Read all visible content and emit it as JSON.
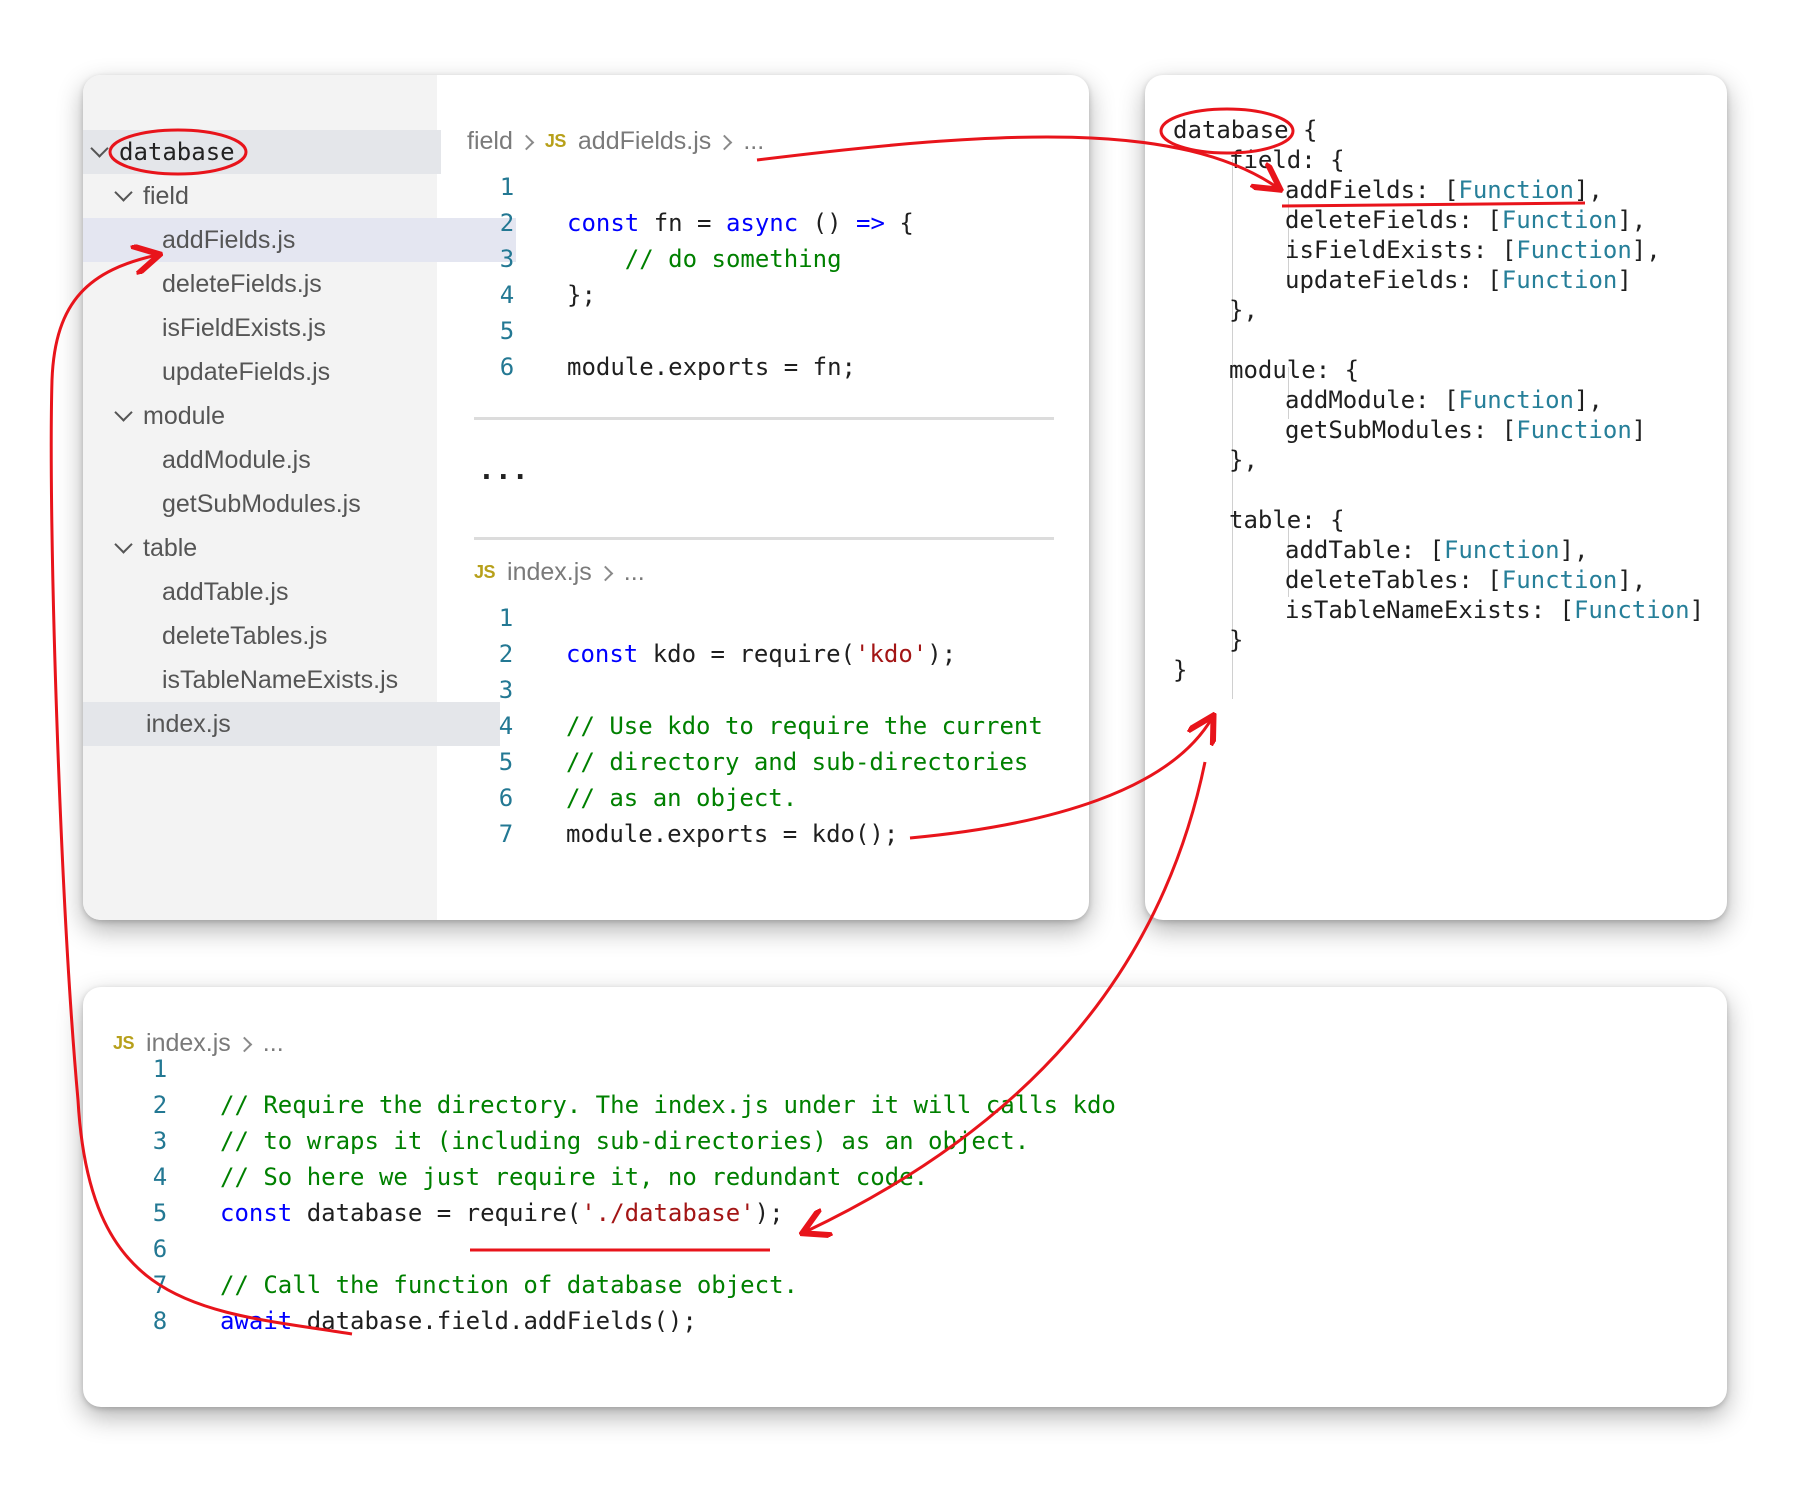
{
  "explorer": {
    "root": "database",
    "items": [
      {
        "label": "field",
        "type": "folder"
      },
      {
        "label": "addFields.js",
        "type": "file"
      },
      {
        "label": "deleteFields.js",
        "type": "file"
      },
      {
        "label": "isFieldExists.js",
        "type": "file"
      },
      {
        "label": "updateFields.js",
        "type": "file"
      },
      {
        "label": "module",
        "type": "folder"
      },
      {
        "label": "addModule.js",
        "type": "file"
      },
      {
        "label": "getSubModules.js",
        "type": "file"
      },
      {
        "label": "table",
        "type": "folder"
      },
      {
        "label": "addTable.js",
        "type": "file"
      },
      {
        "label": "deleteTables.js",
        "type": "file"
      },
      {
        "label": "isTableNameExists.js",
        "type": "file"
      },
      {
        "label": "index.js",
        "type": "file"
      }
    ]
  },
  "editor_top": {
    "breadcrumb": {
      "folder": "field",
      "badge": "JS",
      "file": "addFields.js",
      "more": "..."
    },
    "lines": [
      {
        "n": "1",
        "parts": []
      },
      {
        "n": "2",
        "parts": [
          {
            "t": "const",
            "c": "kw"
          },
          {
            "t": " fn = "
          },
          {
            "t": "async",
            "c": "kw"
          },
          {
            "t": " () "
          },
          {
            "t": "=>",
            "c": "kw"
          },
          {
            "t": " {"
          }
        ]
      },
      {
        "n": "3",
        "parts": [
          {
            "t": "    // do something",
            "c": "cmt"
          }
        ]
      },
      {
        "n": "4",
        "parts": [
          {
            "t": "};"
          }
        ]
      },
      {
        "n": "5",
        "parts": []
      },
      {
        "n": "6",
        "parts": [
          {
            "t": "module.exports = fn;"
          }
        ]
      }
    ],
    "ellipsis": "..."
  },
  "editor_index": {
    "breadcrumb": {
      "badge": "JS",
      "file": "index.js",
      "more": "..."
    },
    "lines": [
      {
        "n": "1",
        "parts": []
      },
      {
        "n": "2",
        "parts": [
          {
            "t": "const",
            "c": "kw"
          },
          {
            "t": " kdo = require("
          },
          {
            "t": "'kdo'",
            "c": "str"
          },
          {
            "t": ");"
          }
        ]
      },
      {
        "n": "3",
        "parts": []
      },
      {
        "n": "4",
        "parts": [
          {
            "t": "// Use kdo to require the current",
            "c": "cmt"
          }
        ]
      },
      {
        "n": "5",
        "parts": [
          {
            "t": "// directory and sub-directories",
            "c": "cmt"
          }
        ]
      },
      {
        "n": "6",
        "parts": [
          {
            "t": "// as an object.",
            "c": "cmt"
          }
        ]
      },
      {
        "n": "7",
        "parts": [
          {
            "t": "module.exports = kdo();"
          }
        ]
      }
    ]
  },
  "object_view": {
    "lines": [
      {
        "indent": 0,
        "parts": [
          {
            "t": "database"
          },
          {
            "t": " {"
          }
        ]
      },
      {
        "indent": 1,
        "parts": [
          {
            "t": "field: {"
          }
        ]
      },
      {
        "indent": 2,
        "parts": [
          {
            "t": "addFields: ["
          },
          {
            "t": "Function",
            "c": "ty"
          },
          {
            "t": "],"
          }
        ]
      },
      {
        "indent": 2,
        "parts": [
          {
            "t": "deleteFields: ["
          },
          {
            "t": "Function",
            "c": "ty"
          },
          {
            "t": "],"
          }
        ]
      },
      {
        "indent": 2,
        "parts": [
          {
            "t": "isFieldExists: ["
          },
          {
            "t": "Function",
            "c": "ty"
          },
          {
            "t": "],"
          }
        ]
      },
      {
        "indent": 2,
        "parts": [
          {
            "t": "updateFields: ["
          },
          {
            "t": "Function",
            "c": "ty"
          },
          {
            "t": "]"
          }
        ]
      },
      {
        "indent": 1,
        "parts": [
          {
            "t": "},"
          }
        ]
      },
      {
        "indent": 1,
        "parts": []
      },
      {
        "indent": 1,
        "parts": [
          {
            "t": "module: {"
          }
        ]
      },
      {
        "indent": 2,
        "parts": [
          {
            "t": "addModule: ["
          },
          {
            "t": "Function",
            "c": "ty"
          },
          {
            "t": "],"
          }
        ]
      },
      {
        "indent": 2,
        "parts": [
          {
            "t": "getSubModules: ["
          },
          {
            "t": "Function",
            "c": "ty"
          },
          {
            "t": "]"
          }
        ]
      },
      {
        "indent": 1,
        "parts": [
          {
            "t": "},"
          }
        ]
      },
      {
        "indent": 1,
        "parts": []
      },
      {
        "indent": 1,
        "parts": [
          {
            "t": "table: {"
          }
        ]
      },
      {
        "indent": 2,
        "parts": [
          {
            "t": "addTable: ["
          },
          {
            "t": "Function",
            "c": "ty"
          },
          {
            "t": "],"
          }
        ]
      },
      {
        "indent": 2,
        "parts": [
          {
            "t": "deleteTables: ["
          },
          {
            "t": "Function",
            "c": "ty"
          },
          {
            "t": "],"
          }
        ]
      },
      {
        "indent": 2,
        "parts": [
          {
            "t": "isTableNameExists: ["
          },
          {
            "t": "Function",
            "c": "ty"
          },
          {
            "t": "]"
          }
        ]
      },
      {
        "indent": 1,
        "parts": [
          {
            "t": "}"
          }
        ]
      },
      {
        "indent": 0,
        "parts": [
          {
            "t": "}"
          }
        ]
      }
    ]
  },
  "editor_bottom": {
    "breadcrumb": {
      "badge": "JS",
      "file": "index.js",
      "more": "..."
    },
    "lines": [
      {
        "n": "1",
        "parts": []
      },
      {
        "n": "2",
        "parts": [
          {
            "t": "// Require the directory. The index.js under it will calls kdo",
            "c": "cmt"
          }
        ]
      },
      {
        "n": "3",
        "parts": [
          {
            "t": "// to wraps it (including sub-directories) as an object.",
            "c": "cmt"
          }
        ]
      },
      {
        "n": "4",
        "parts": [
          {
            "t": "// So here we just require it, no redundant code.",
            "c": "cmt"
          }
        ]
      },
      {
        "n": "5",
        "parts": [
          {
            "t": "const",
            "c": "kw"
          },
          {
            "t": " database = require("
          },
          {
            "t": "'./database'",
            "c": "str"
          },
          {
            "t": ");"
          }
        ]
      },
      {
        "n": "6",
        "parts": []
      },
      {
        "n": "7",
        "parts": [
          {
            "t": "// Call the function of database object.",
            "c": "cmt"
          }
        ]
      },
      {
        "n": "8",
        "parts": [
          {
            "t": "await",
            "c": "kw"
          },
          {
            "t": " database.field.addFields();"
          }
        ]
      }
    ]
  },
  "colors": {
    "annotation": "#e8141b",
    "keyword": "#0000ff",
    "string": "#a31515",
    "comment": "#008000",
    "type": "#267f99",
    "line_number": "#237893"
  }
}
